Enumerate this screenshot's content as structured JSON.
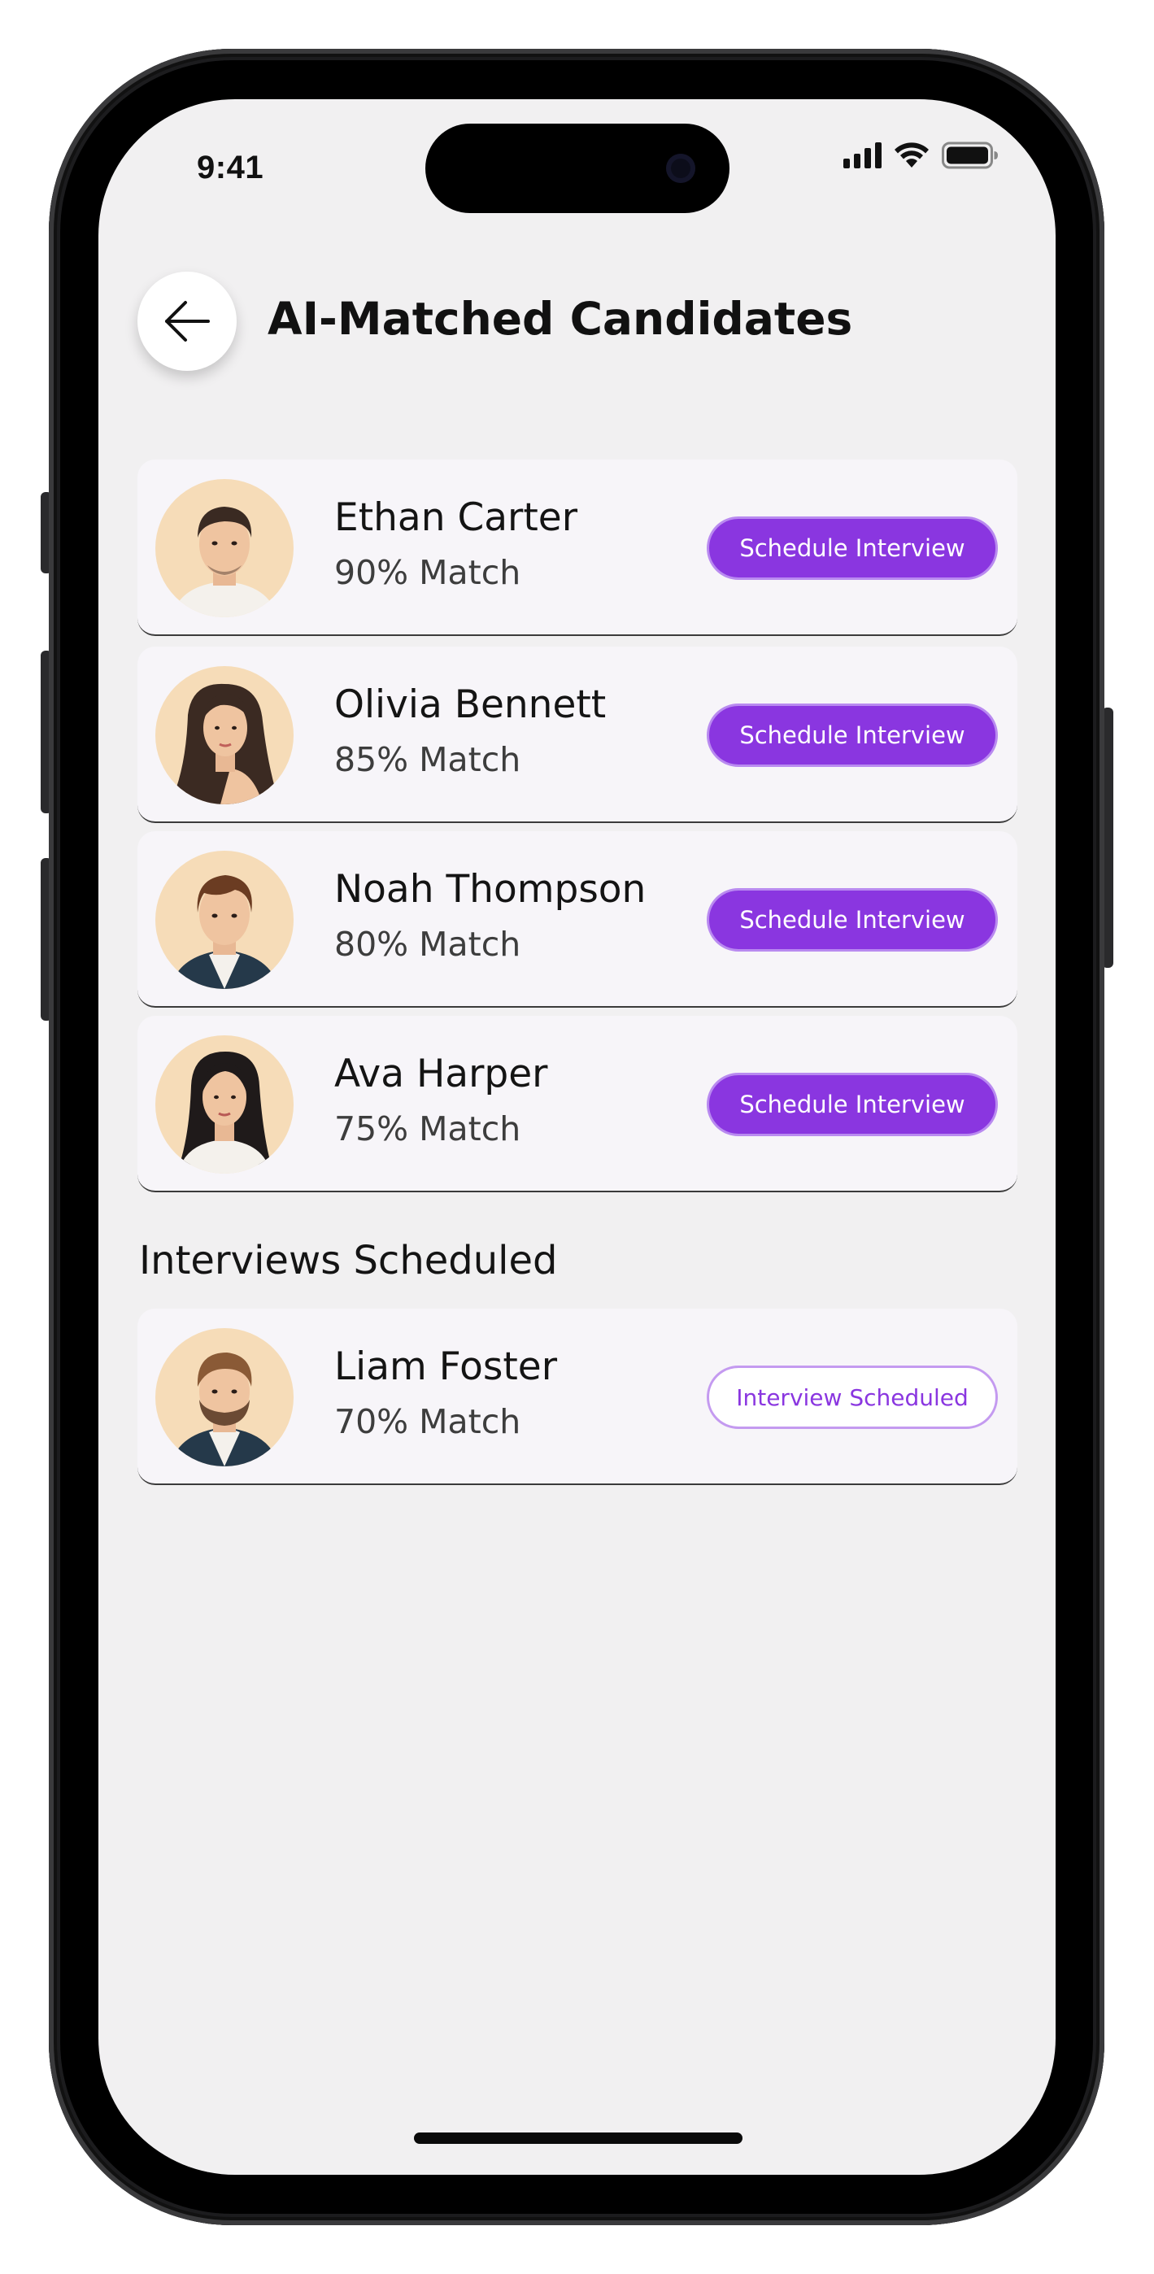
{
  "status_bar": {
    "time": "9:41"
  },
  "header": {
    "back_icon": "arrow-left-icon",
    "title": "AI-Matched Candidates"
  },
  "candidates": [
    {
      "name": "Ethan Carter",
      "match": "90% Match",
      "action": "Schedule Interview",
      "avatar": "man-short-hair-avatar"
    },
    {
      "name": "Olivia Bennett",
      "match": "85% Match",
      "action": "Schedule Interview",
      "avatar": "woman-long-hair-avatar"
    },
    {
      "name": "Noah Thompson",
      "match": "80% Match",
      "action": "Schedule Interview",
      "avatar": "man-jacket-avatar"
    },
    {
      "name": "Ava Harper",
      "match": "75% Match",
      "action": "Schedule Interview",
      "avatar": "woman-dark-hair-avatar"
    }
  ],
  "scheduled_section": {
    "heading": "Interviews Scheduled",
    "items": [
      {
        "name": "Liam Foster",
        "match": "70% Match",
        "status": "Interview Scheduled",
        "avatar": "man-beard-avatar"
      }
    ]
  },
  "colors": {
    "accent": "#8a36e0",
    "accent_border": "#b98af0",
    "card_bg": "#f7f5f9",
    "screen_bg": "#f1f0f1",
    "avatar_bg": "#f6dcb8"
  }
}
